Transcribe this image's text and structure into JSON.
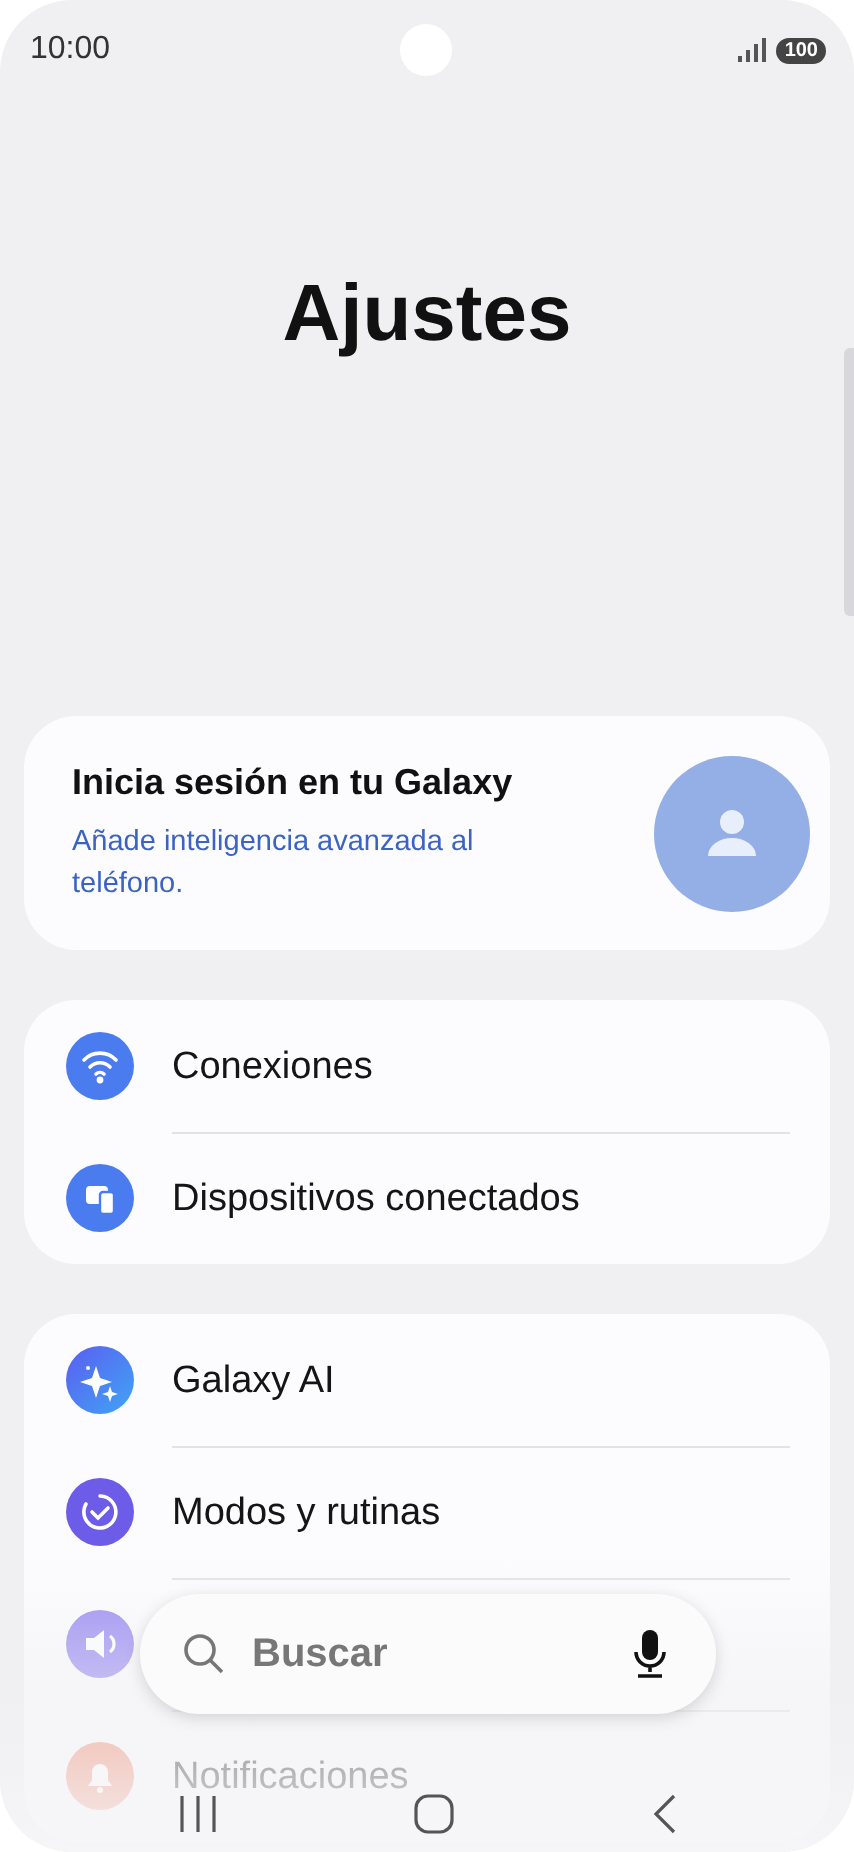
{
  "status_bar": {
    "time": "10:00",
    "battery": "100"
  },
  "title": "Ajustes",
  "account_card": {
    "title": "Inicia sesión en tu Galaxy",
    "subtitle": "Añade inteligencia avanzada al teléfono."
  },
  "groups": [
    {
      "items": [
        {
          "kind": "labeled",
          "label": "Conexiones"
        },
        {
          "kind": "labeled",
          "label": "Dispositivos conectados"
        }
      ]
    },
    {
      "items": [
        {
          "kind": "labeled",
          "label": "Galaxy AI"
        },
        {
          "kind": "labeled",
          "label": "Modos y rutinas"
        },
        {
          "kind": "covered"
        },
        {
          "kind": "labeled",
          "label": "Notificaciones"
        }
      ]
    }
  ],
  "search": {
    "placeholder": "Buscar"
  }
}
